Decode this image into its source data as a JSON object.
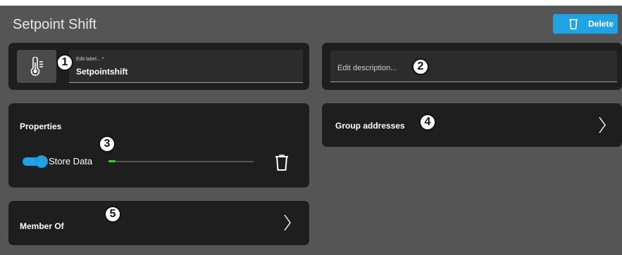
{
  "header": {
    "title": "Setpoint Shift",
    "delete_label": "Delete",
    "accent_color": "#1ea3e6"
  },
  "label_card": {
    "icon": "thermometer-icon",
    "field_label": "Edit label... *",
    "field_value": "Setpointshift",
    "badge": "1"
  },
  "description_card": {
    "placeholder": "Edit description...",
    "badge": "2"
  },
  "properties": {
    "title": "Properties",
    "badge": "3",
    "store_data_label": "Store Data",
    "store_data_on": true,
    "progress_fraction": 0.05,
    "progress_color": "#36c736"
  },
  "group_addresses": {
    "title": "Group addresses",
    "badge": "4"
  },
  "member_of": {
    "title": "Member Of",
    "badge": "5"
  }
}
